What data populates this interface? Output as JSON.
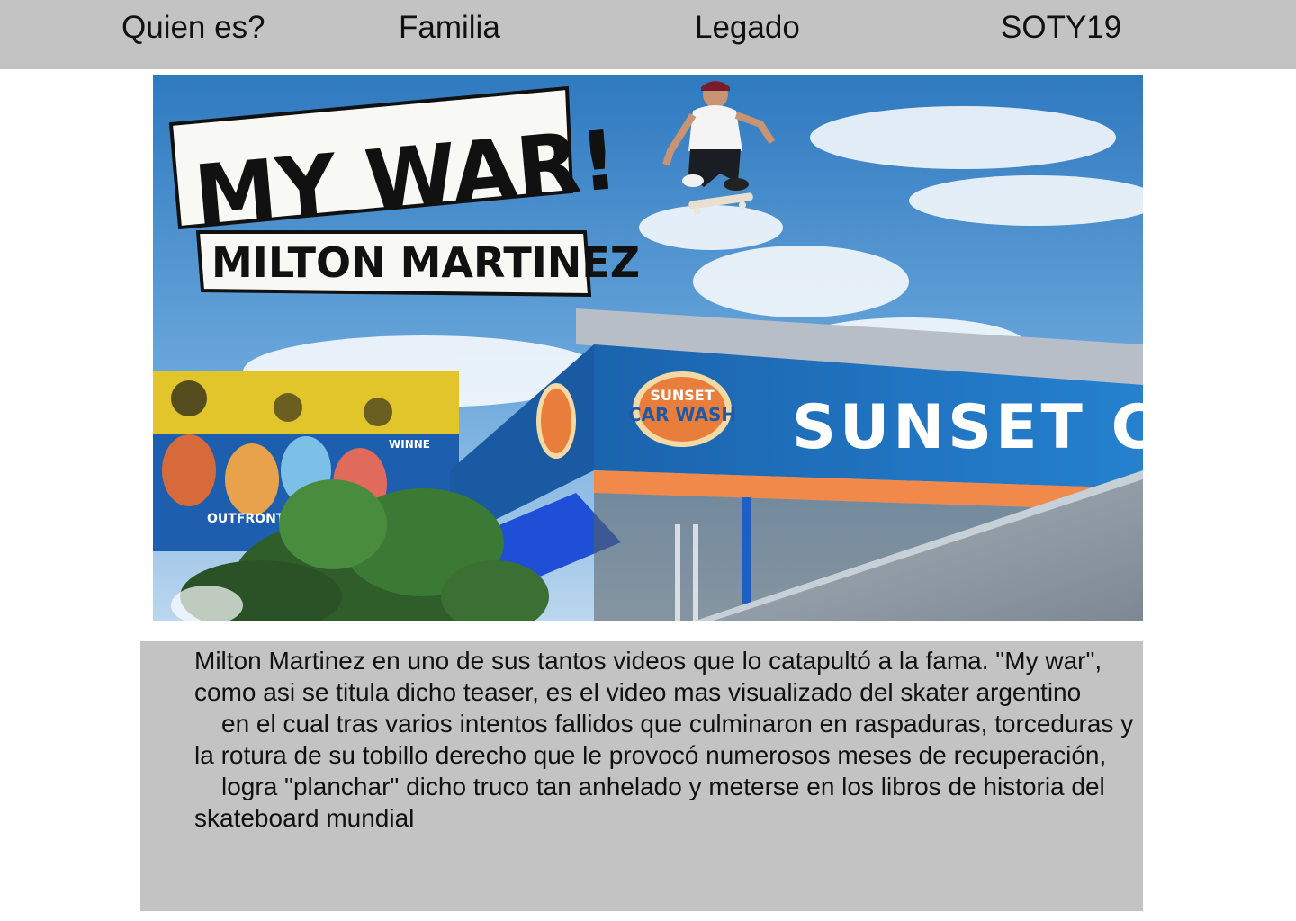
{
  "nav": {
    "items": [
      {
        "label": "Quien es?"
      },
      {
        "label": "Familia"
      },
      {
        "label": "Legado"
      },
      {
        "label": "SOTY19"
      }
    ]
  },
  "hero": {
    "poster_title": "MY WAR!",
    "poster_subtitle": "MILTON MARTINEZ",
    "sign_text": "SUNSET CA",
    "logo_text_top": "SUNSET",
    "logo_text_bottom": "CAR WASH",
    "billboard_text": "OUTFRONT",
    "billboard_winner": "WINNE"
  },
  "caption": {
    "paragraph_1": "Milton Martinez en uno de sus tantos videos que lo catapultó a la fama. \"My war\", como asi se titula dicho teaser, es el video mas visualizado del skater argentino",
    "paragraph_2": "en el cual tras varios intentos fallidos que culminaron en raspaduras, torceduras y la rotura de su tobillo derecho que le provocó numerosos meses de recuperación,",
    "paragraph_3": "logra \"planchar\" dicho truco tan anhelado y meterse en los libros de historia del skateboard mundial"
  },
  "colors": {
    "nav_bg": "#c3c3c3",
    "caption_bg": "#c3c3c3",
    "sky_top": "#3f86c6",
    "sign_blue": "#1f6fb5",
    "awning_blue": "#1e4fd6",
    "ramp_gray": "#8e9aa6"
  }
}
